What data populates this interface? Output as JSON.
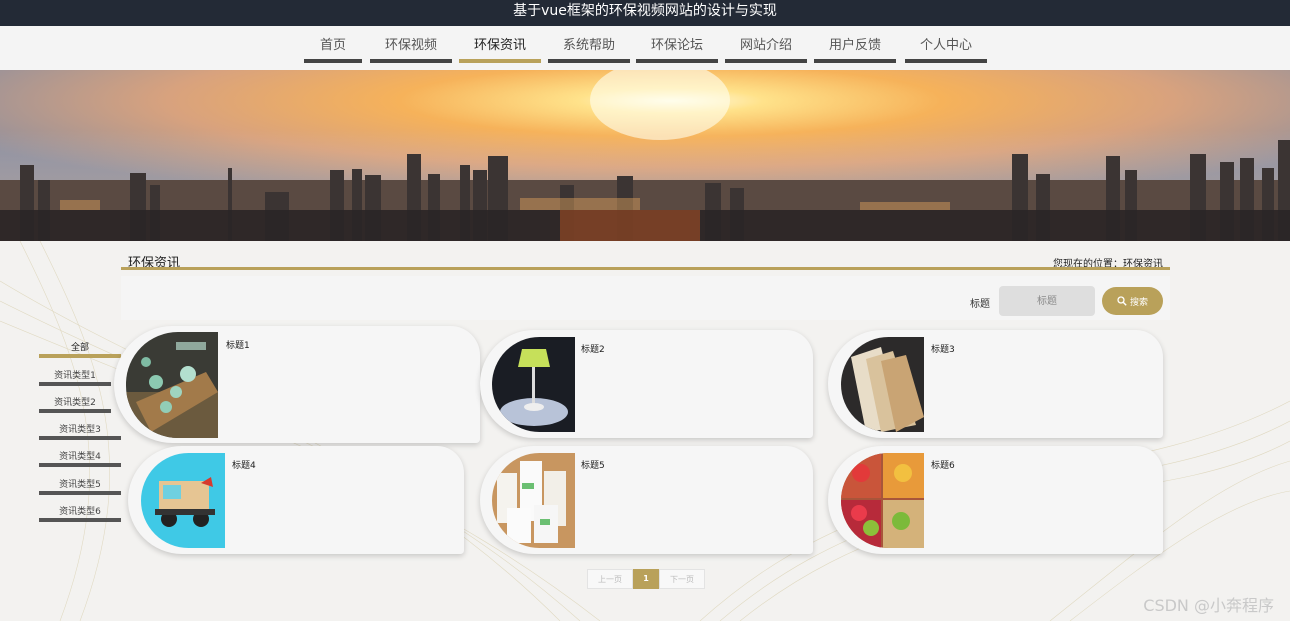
{
  "site_title": "基于vue框架的环保视频网站的设计与实现",
  "nav": [
    {
      "label": "首页"
    },
    {
      "label": "环保视频"
    },
    {
      "label": "环保资讯",
      "active": true
    },
    {
      "label": "系统帮助"
    },
    {
      "label": "环保论坛"
    },
    {
      "label": "网站介绍"
    },
    {
      "label": "用户反馈"
    },
    {
      "label": "个人中心"
    }
  ],
  "section": {
    "title": "环保资讯",
    "breadcrumb": "您现在的位置：环保资讯"
  },
  "search": {
    "label": "标题",
    "placeholder": "标题",
    "button_label": "搜索",
    "button_icon": "search-icon"
  },
  "categories": [
    {
      "label": "全部",
      "active": true
    },
    {
      "label": "资讯类型1"
    },
    {
      "label": "资讯类型2"
    },
    {
      "label": "资讯类型3"
    },
    {
      "label": "资讯类型4"
    },
    {
      "label": "资讯类型5"
    },
    {
      "label": "资讯类型6"
    }
  ],
  "news": [
    {
      "title": "标题1",
      "image": "tea-set"
    },
    {
      "title": "标题2",
      "image": "desk-lamp"
    },
    {
      "title": "标题3",
      "image": "wood-veneer"
    },
    {
      "title": "标题4",
      "image": "toy-car"
    },
    {
      "title": "标题5",
      "image": "paper-cups"
    },
    {
      "title": "标题6",
      "image": "fruit-boxes"
    }
  ],
  "pagination": {
    "prev": "上一页",
    "current": "1",
    "next": "下一页"
  },
  "watermark": "CSDN @小奔程序",
  "colors": {
    "accent": "#b9a15a",
    "topbar": "#232a36",
    "nav_underline": "#444444"
  }
}
